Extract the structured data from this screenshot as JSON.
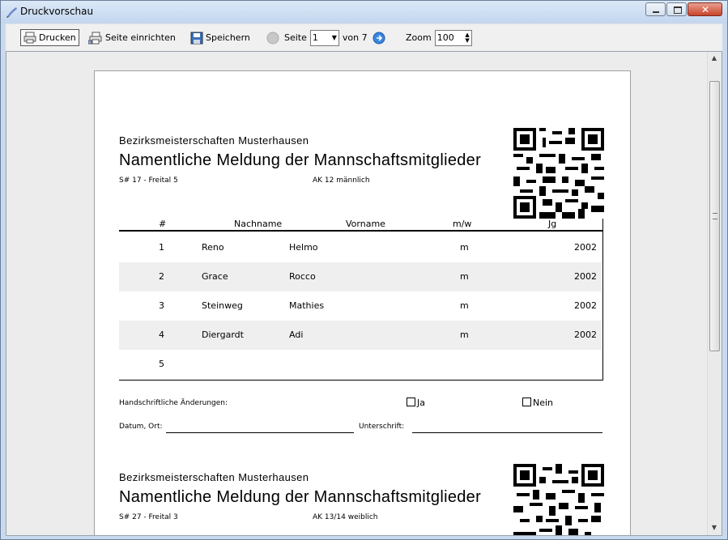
{
  "window": {
    "title": "Druckvorschau"
  },
  "toolbar": {
    "print_label": "Drucken",
    "page_setup_label": "Seite einrichten",
    "save_label": "Speichern",
    "page_label": "Seite",
    "page_value": "1",
    "of_label": "von 7",
    "zoom_label": "Zoom",
    "zoom_value": "100"
  },
  "document": {
    "sheets": [
      {
        "club": "Bezirksmeisterschaften Musterhausen",
        "heading": "Namentliche Meldung der Mannschaftsmitglieder",
        "team": "S# 17 - Freital 5",
        "age_class": "AK 12 männlich"
      },
      {
        "club": "Bezirksmeisterschaften Musterhausen",
        "heading": "Namentliche Meldung der Mannschaftsmitglieder",
        "team": "S# 27 - Freital 3",
        "age_class": "AK 13/14 weiblich"
      }
    ],
    "table": {
      "headers": [
        "#",
        "Nachname",
        "Vorname",
        "m/w",
        "Jg"
      ],
      "rows": [
        {
          "num": "1",
          "last": "Reno",
          "first": "Helmo",
          "gender": "m",
          "year": "2002"
        },
        {
          "num": "2",
          "last": "Grace",
          "first": "Rocco",
          "gender": "m",
          "year": "2002"
        },
        {
          "num": "3",
          "last": "Steinweg",
          "first": "Mathies",
          "gender": "m",
          "year": "2002"
        },
        {
          "num": "4",
          "last": "Diergardt",
          "first": "Adi",
          "gender": "m",
          "year": "2002"
        },
        {
          "num": "5",
          "last": "",
          "first": "",
          "gender": "",
          "year": ""
        }
      ]
    },
    "form": {
      "changes_label": "Handschriftliche Änderungen:",
      "yes_label": "Ja",
      "no_label": "Nein",
      "date_place_label": "Datum, Ort:",
      "signature_label": "Unterschrift:"
    }
  },
  "colors": {
    "titlebar": "#c9daee",
    "close": "#c8432b",
    "row_shade": "#efefef"
  }
}
